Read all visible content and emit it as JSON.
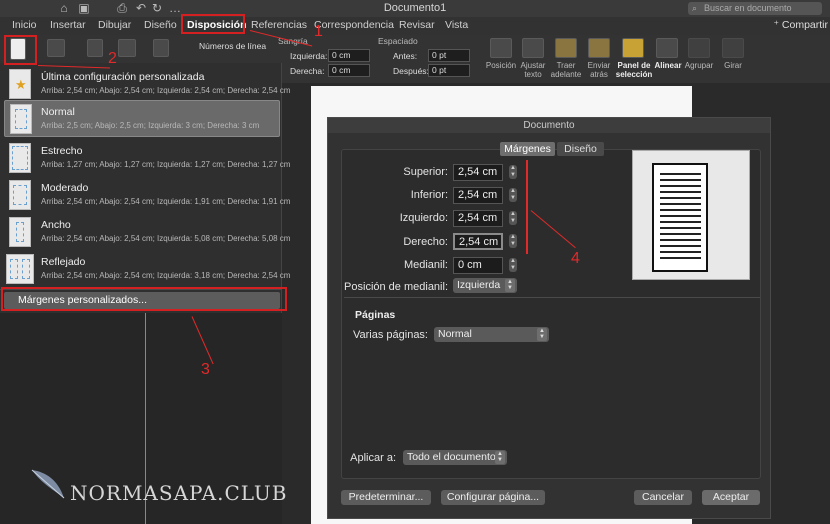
{
  "window": {
    "title": "Documento1",
    "search_placeholder": "Buscar en documento",
    "share_label": "Compartir"
  },
  "tabs": [
    "Inicio",
    "Insertar",
    "Dibujar",
    "Diseño",
    "Disposición",
    "Referencias",
    "Correspondencia",
    "Revisar",
    "Vista"
  ],
  "ribbon": {
    "line_numbers": "Números de línea",
    "indent_title": "Sangría",
    "indent_left_label": "Izquierda:",
    "indent_left_value": "0 cm",
    "indent_right_label": "Derecha:",
    "indent_right_value": "0 cm",
    "spacing_title": "Espaciado",
    "spacing_before_label": "Antes:",
    "spacing_before_value": "0 pt",
    "spacing_after_label": "Después:",
    "spacing_after_value": "0 pt",
    "arrange": [
      "Posición",
      "Ajustar texto",
      "Traer adelante",
      "Enviar atrás",
      "Panel de selección",
      "Alinear",
      "Agrupar",
      "Girar"
    ]
  },
  "margin_presets": [
    {
      "name": "Última configuración personalizada",
      "desc": "Arriba: 2,54 cm; Abajo: 2,54 cm; Izquierda: 2,54 cm; Derecha: 2,54 cm"
    },
    {
      "name": "Normal",
      "desc": "Arriba: 2,5 cm; Abajo: 2,5 cm; Izquierda: 3 cm; Derecha: 3 cm"
    },
    {
      "name": "Estrecho",
      "desc": "Arriba: 1,27 cm; Abajo: 1,27 cm; Izquierda: 1,27 cm; Derecha: 1,27 cm"
    },
    {
      "name": "Moderado",
      "desc": "Arriba: 2,54 cm; Abajo: 2,54 cm; Izquierda: 1,91 cm; Derecha: 1,91 cm"
    },
    {
      "name": "Ancho",
      "desc": "Arriba: 2,54 cm; Abajo: 2,54 cm; Izquierda: 5,08 cm; Derecha: 5,08 cm"
    },
    {
      "name": "Reflejado",
      "desc": "Arriba: 2,54 cm; Abajo: 2,54 cm; Izquierda: 3,18 cm; Derecha: 2,54 cm"
    }
  ],
  "custom_margins_label": "Márgenes personalizados...",
  "dialog": {
    "title": "Documento",
    "tab_margins": "Márgenes",
    "tab_layout": "Diseño",
    "top_label": "Superior:",
    "top_value": "2,54 cm",
    "bottom_label": "Inferior:",
    "bottom_value": "2,54 cm",
    "left_label": "Izquierdo:",
    "left_value": "2,54 cm",
    "right_label": "Derecho:",
    "right_value": "2,54 cm",
    "gutter_label": "Medianil:",
    "gutter_value": "0 cm",
    "gutter_pos_label": "Posición de medianil:",
    "gutter_pos_value": "Izquierda",
    "pages_title": "Páginas",
    "multiple_pages_label": "Varias páginas:",
    "multiple_pages_value": "Normal",
    "apply_to_label": "Aplicar a:",
    "apply_to_value": "Todo el documento",
    "btn_default": "Predeterminar...",
    "btn_page_setup": "Configurar página...",
    "btn_cancel": "Cancelar",
    "btn_ok": "Aceptar"
  },
  "annotations": [
    "1",
    "2",
    "3",
    "4"
  ],
  "watermark": "NORMASAPA.CLUB"
}
